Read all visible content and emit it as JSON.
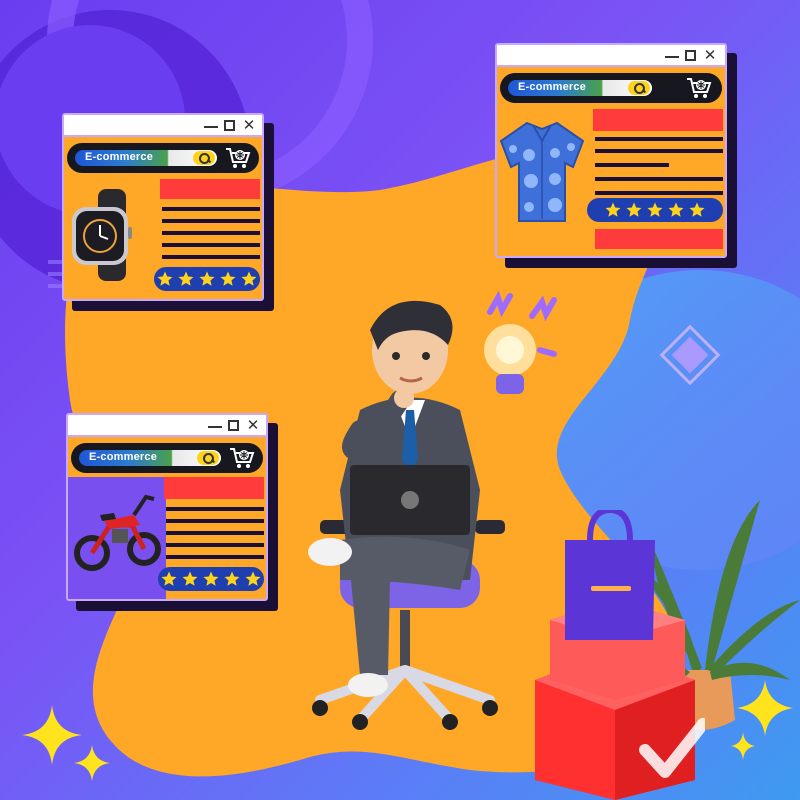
{
  "windows": [
    {
      "id": "watch-window",
      "search_label": "E-commerce",
      "product_icon": "smartwatch-icon",
      "rating_stars": 5
    },
    {
      "id": "shirt-window",
      "search_label": "E-commerce",
      "product_icon": "shirt-icon",
      "rating_stars": 5
    },
    {
      "id": "motorbike-window",
      "search_label": "E-commerce",
      "product_icon": "motorbike-icon",
      "rating_stars": 5
    }
  ],
  "icons": {
    "window_controls": [
      "minimize-icon",
      "maximize-icon",
      "close-icon"
    ],
    "search": "search-icon",
    "cart": "shopping-cart-icon",
    "idea": "lightbulb-icon",
    "shopping_bag": "shopping-bag-icon",
    "package": "package-box-icon",
    "check": "checkmark-icon",
    "plant": "plant-icon",
    "sparkle": "sparkle-icon"
  },
  "colors": {
    "background_purple": "#6a3df0",
    "blob_orange": "#ffa726",
    "window_border": "#c9a8ff",
    "accent_red": "#ff3b3b",
    "rating_blue": "#1f3fb0",
    "star_yellow": "#ffd21c"
  }
}
